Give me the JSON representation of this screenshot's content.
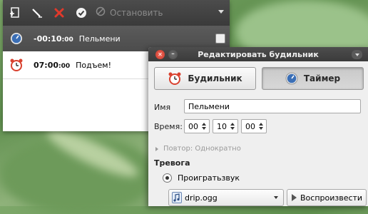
{
  "main": {
    "toolbar": {
      "stop_label": "Остановить"
    },
    "rows": [
      {
        "time": "-00:10",
        "time_small": ":00",
        "label": "Пельмени"
      },
      {
        "time": "07:00",
        "time_small": ":00",
        "label": "Подъем!"
      }
    ]
  },
  "dialog": {
    "title": "Редактировать будильник",
    "alarm_button": "Будильник",
    "timer_button": "Таймер",
    "name_label": "Имя",
    "name_value": "Пельмени",
    "time_label": "Время:",
    "hours": "00",
    "minutes": "10",
    "seconds": "00",
    "repeat": "Повтор: Однократно",
    "alert_section": "Тревога",
    "play_sound_label": "Проигратьзвук",
    "sound_file": "drip.ogg",
    "play_button": "Воспроизвести"
  },
  "colors": {
    "toolbar": "#3f3f3f",
    "selected_row": "#525252",
    "close_red": "#d9412f",
    "accent_blue": "#3b6fb6"
  }
}
